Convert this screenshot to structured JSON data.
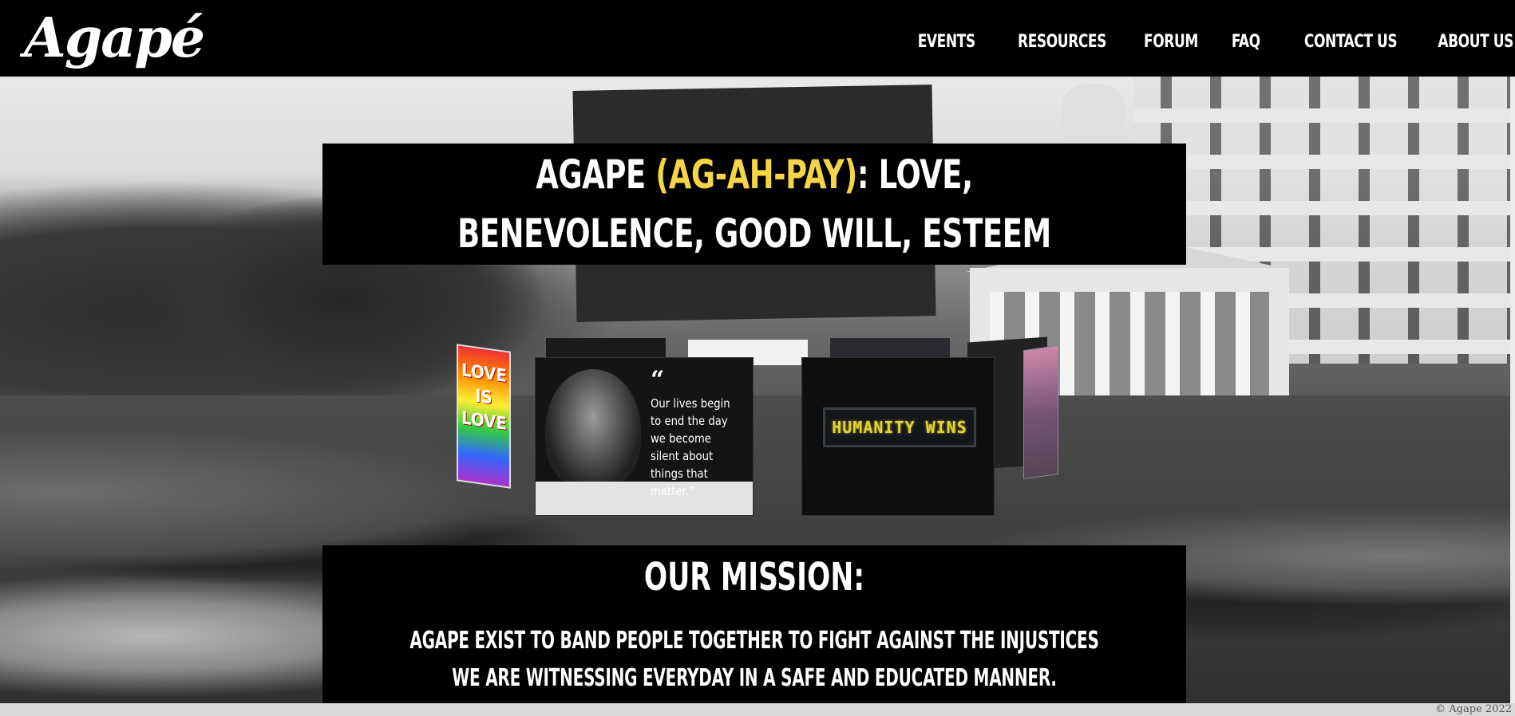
{
  "header": {
    "logo_text": "Agapé",
    "nav": [
      {
        "label": "EVENTS"
      },
      {
        "label": "RESOURCES"
      },
      {
        "label": "FORUM"
      },
      {
        "label": "FAQ"
      },
      {
        "label": "CONTACT US"
      },
      {
        "label": "ABOUT US"
      }
    ]
  },
  "hero": {
    "title_prefix": "AGAPE ",
    "title_highlight": "(AG-AH-PAY)",
    "title_suffix": ": LOVE, BENEVOLENCE, GOOD WILL, ESTEEM",
    "highlight_color": "#f5d547",
    "cards": {
      "quote_mark": "“",
      "quote_text": "Our lives begin to end the day we become silent about things that matter.”",
      "humanity_sign": "HUMANITY WINS",
      "love_sign": "LOVE IS LOVE"
    }
  },
  "mission": {
    "heading": "OUR MISSION:",
    "body": "AGAPE EXIST TO BAND PEOPLE TOGETHER TO FIGHT AGAINST THE INJUSTICES WE ARE WITNESSING EVERYDAY IN A SAFE AND EDUCATED MANNER."
  },
  "footer": {
    "copyright": "© Agape 2022"
  }
}
